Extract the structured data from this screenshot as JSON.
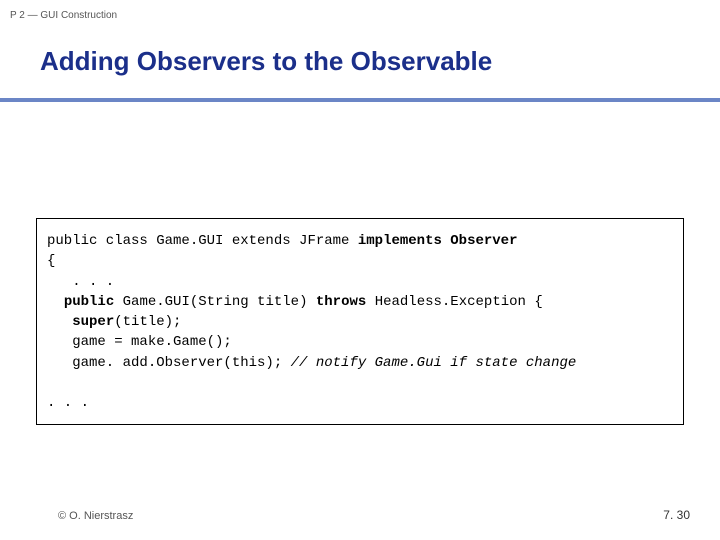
{
  "header": {
    "label": "P 2 — GUI Construction",
    "title": "Adding Observers to the Observable"
  },
  "code": {
    "l1a": "public class Game.GUI extends JFrame ",
    "l1b": "implements Observer",
    "l2": "{",
    "l3": "   . . .",
    "l4a": "  ",
    "l4b": "public",
    "l4c": " Game.GUI(String title) ",
    "l4d": "throws",
    "l4e": " Headless.Exception {",
    "l5a": "   ",
    "l5b": "super",
    "l5c": "(title);",
    "l6": "   game = make.Game();",
    "l7a": "   game. add.Observer(this); ",
    "l7b": "// notify Game.Gui if state change",
    "l9": ". . ."
  },
  "footer": {
    "copyright": "© O. Nierstrasz",
    "page": "7. 30"
  }
}
